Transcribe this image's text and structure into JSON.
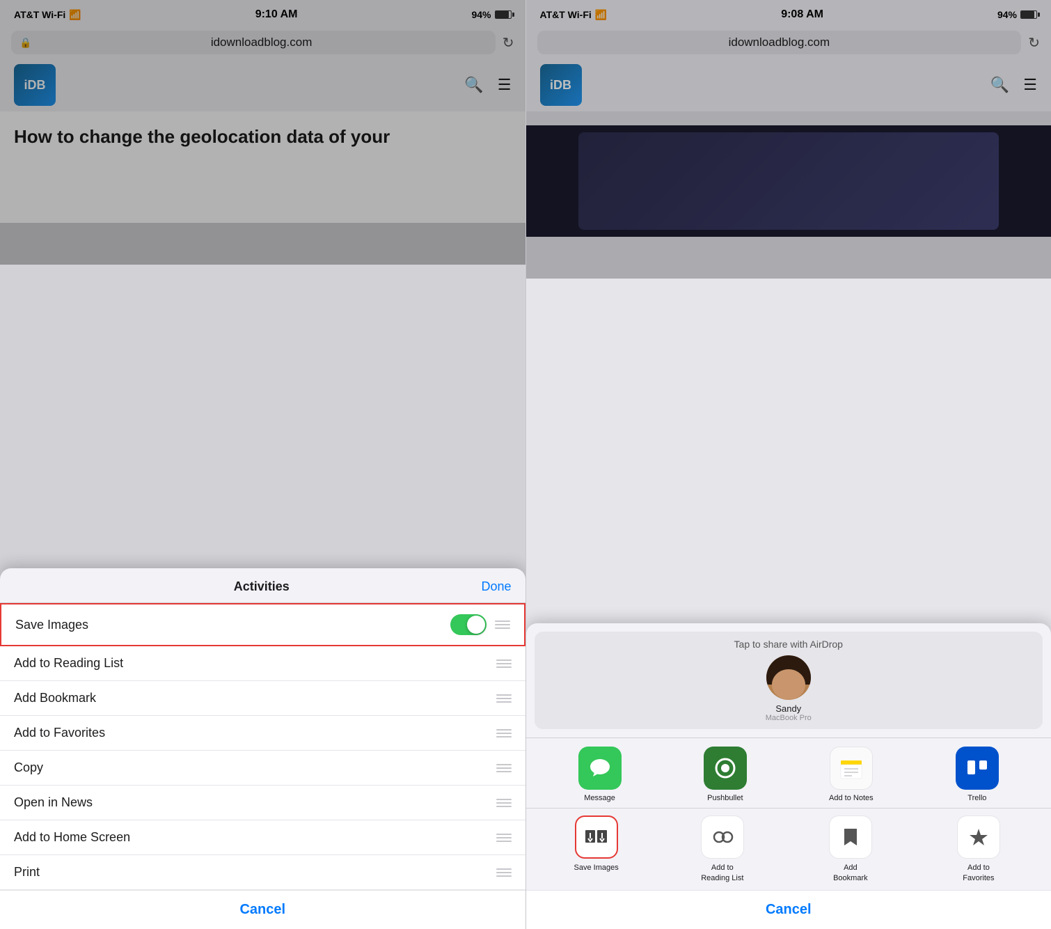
{
  "left": {
    "status": {
      "carrier": "AT&T Wi-Fi",
      "time": "9:10 AM",
      "battery": "94%"
    },
    "url": "idownloadblog.com",
    "article_title": "How to change the geolocation data of your",
    "modal": {
      "title": "Activities",
      "done_label": "Done",
      "items": [
        {
          "label": "Save Images",
          "has_toggle": true,
          "toggle_on": true,
          "highlighted": true
        },
        {
          "label": "Add to Reading List",
          "has_toggle": false
        },
        {
          "label": "Add Bookmark",
          "has_toggle": false
        },
        {
          "label": "Add to Favorites",
          "has_toggle": false
        },
        {
          "label": "Copy",
          "has_toggle": false
        },
        {
          "label": "Open in News",
          "has_toggle": false
        },
        {
          "label": "Add to Home Screen",
          "has_toggle": false
        },
        {
          "label": "Print",
          "has_toggle": false
        }
      ],
      "cancel_label": "Cancel"
    }
  },
  "right": {
    "status": {
      "carrier": "AT&T Wi-Fi",
      "time": "9:08 AM",
      "battery": "94%"
    },
    "url": "idownloadblog.com",
    "share_modal": {
      "airdrop_label": "Tap to share with AirDrop",
      "person": {
        "name": "Sandy",
        "device": "MacBook Pro"
      },
      "apps": [
        {
          "label": "Message",
          "color": "green",
          "icon": "message"
        },
        {
          "label": "Pushbullet",
          "color": "green-alt",
          "icon": "pushbullet"
        },
        {
          "label": "Add to Notes",
          "color": "notes",
          "icon": "notes"
        },
        {
          "label": "Trello",
          "color": "trello",
          "icon": "trello"
        }
      ],
      "actions": [
        {
          "label": "Save Images",
          "icon": "save-images",
          "highlighted": true
        },
        {
          "label": "Add to\nReading List",
          "icon": "reading-list",
          "highlighted": false
        },
        {
          "label": "Add\nBookmark",
          "icon": "bookmark",
          "highlighted": false
        },
        {
          "label": "Add to\nFavorites",
          "icon": "favorites",
          "highlighted": false
        }
      ],
      "cancel_label": "Cancel"
    }
  }
}
